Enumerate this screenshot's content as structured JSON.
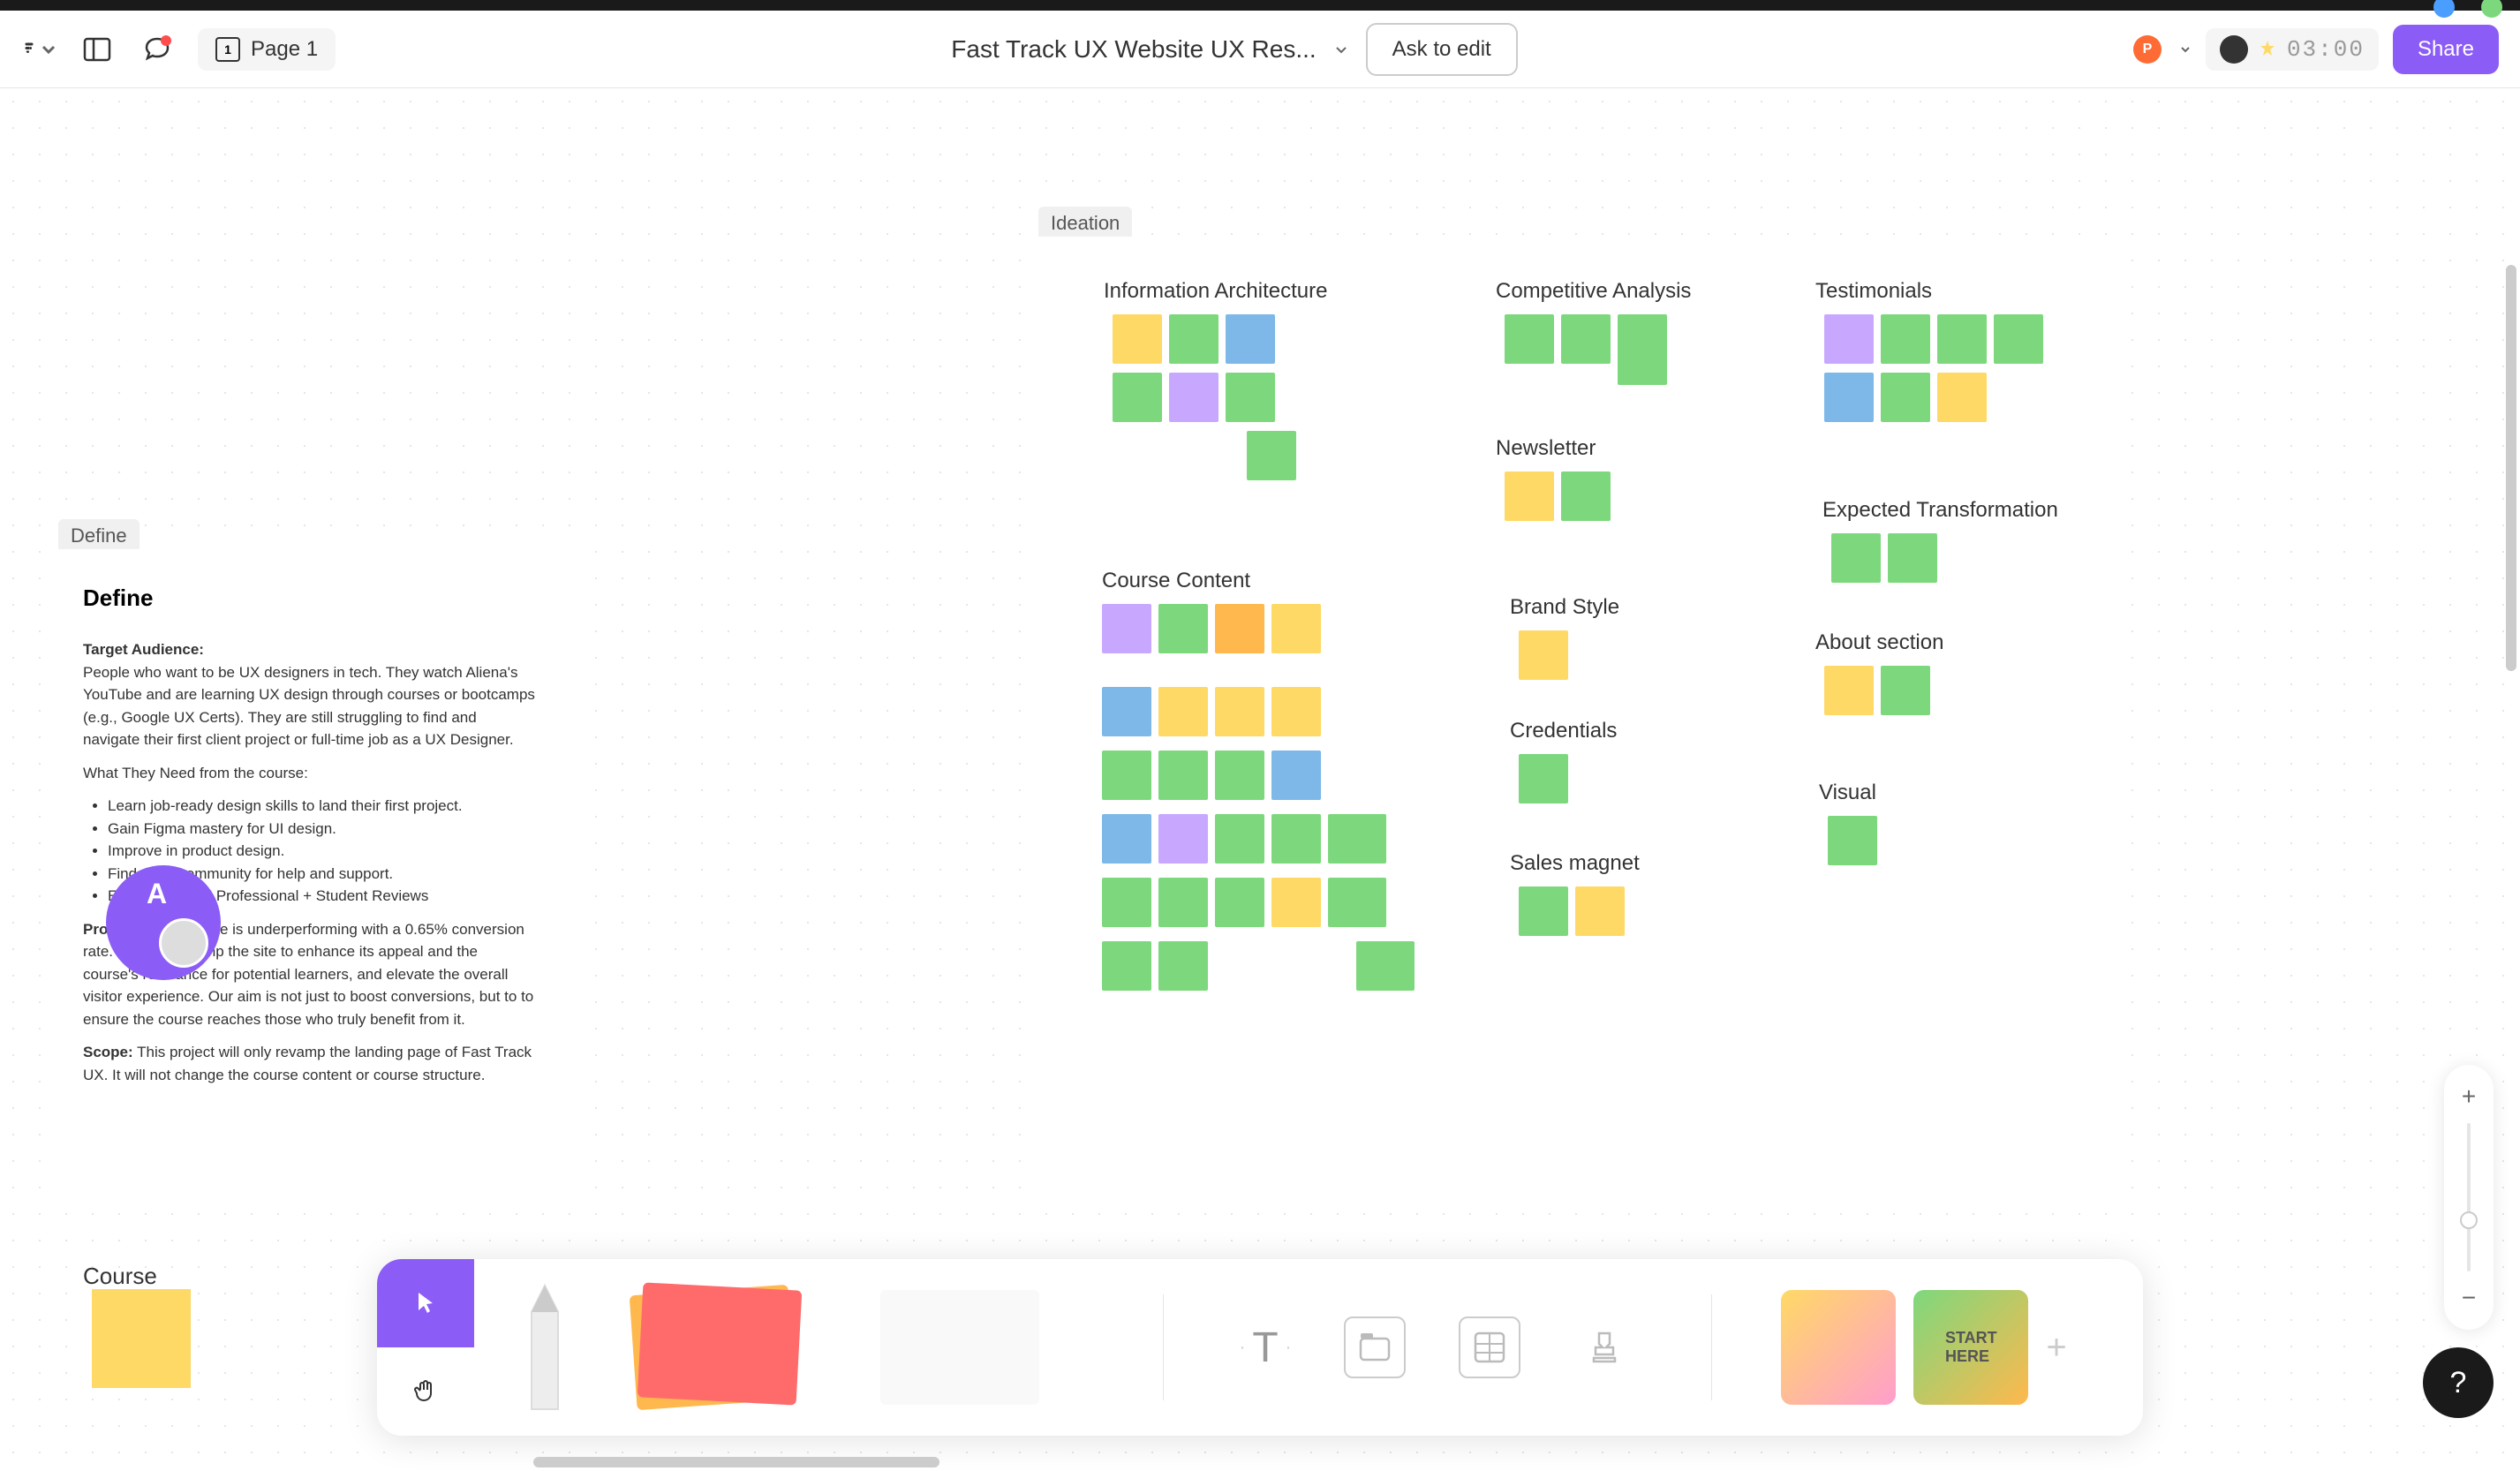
{
  "browser": {
    "url": "figma.com/board/..."
  },
  "toolbar": {
    "page_number": "1",
    "page_label": "Page 1",
    "file_title": "Fast Track UX Website UX Res...",
    "ask_to_edit": "Ask to edit",
    "avatar_initial": "P",
    "timer": "03:00",
    "share": "Share"
  },
  "canvas": {
    "define_label": "Define",
    "ideation_label": "Ideation",
    "define": {
      "title": "Define",
      "target_audience_label": "Target Audience:",
      "target_audience_text": "People who want to be UX designers in tech. They watch Aliena's YouTube and are learning UX design through courses or bootcamps (e.g., Google UX Certs). They are still struggling to find and navigate their first client project or full-time job as a UX Designer.",
      "needs_label": "What They Need from the course:",
      "needs": [
        "Learn job-ready design skills to land their first project.",
        "Gain Figma mastery for UI design.",
        "Improve in product design.",
        "Find a UX community for help and support.",
        "Experience: UX Professional + Student Reviews"
      ],
      "problem_label": "Problem:",
      "problem_text": "UX website is underperforming with a 0.65% conversion rate. Need to revamp the site to enhance its appeal and the course's relevance for potential learners, and elevate the overall visitor experience. Our aim is not just to boost conversions, but to to ensure the course reaches those who truly benefit from it.",
      "scope_label": "Scope:",
      "scope_text": "This project will only revamp the landing page of Fast Track UX. It will not change the course content or course structure."
    },
    "ideation": {
      "sections": {
        "info_arch": "Information Architecture",
        "competitive": "Competitive Analysis",
        "testimonials": "Testimonials",
        "newsletter": "Newsletter",
        "expected": "Expected Transformation",
        "course_content": "Course Content",
        "brand": "Brand Style",
        "credentials": "Credentials",
        "about": "About section",
        "visual": "Visual",
        "sales": "Sales magnet"
      }
    },
    "course_label": "Course",
    "collab_initial": "A"
  },
  "bottom_toolbar": {
    "text_tool": "T"
  },
  "help": "?"
}
